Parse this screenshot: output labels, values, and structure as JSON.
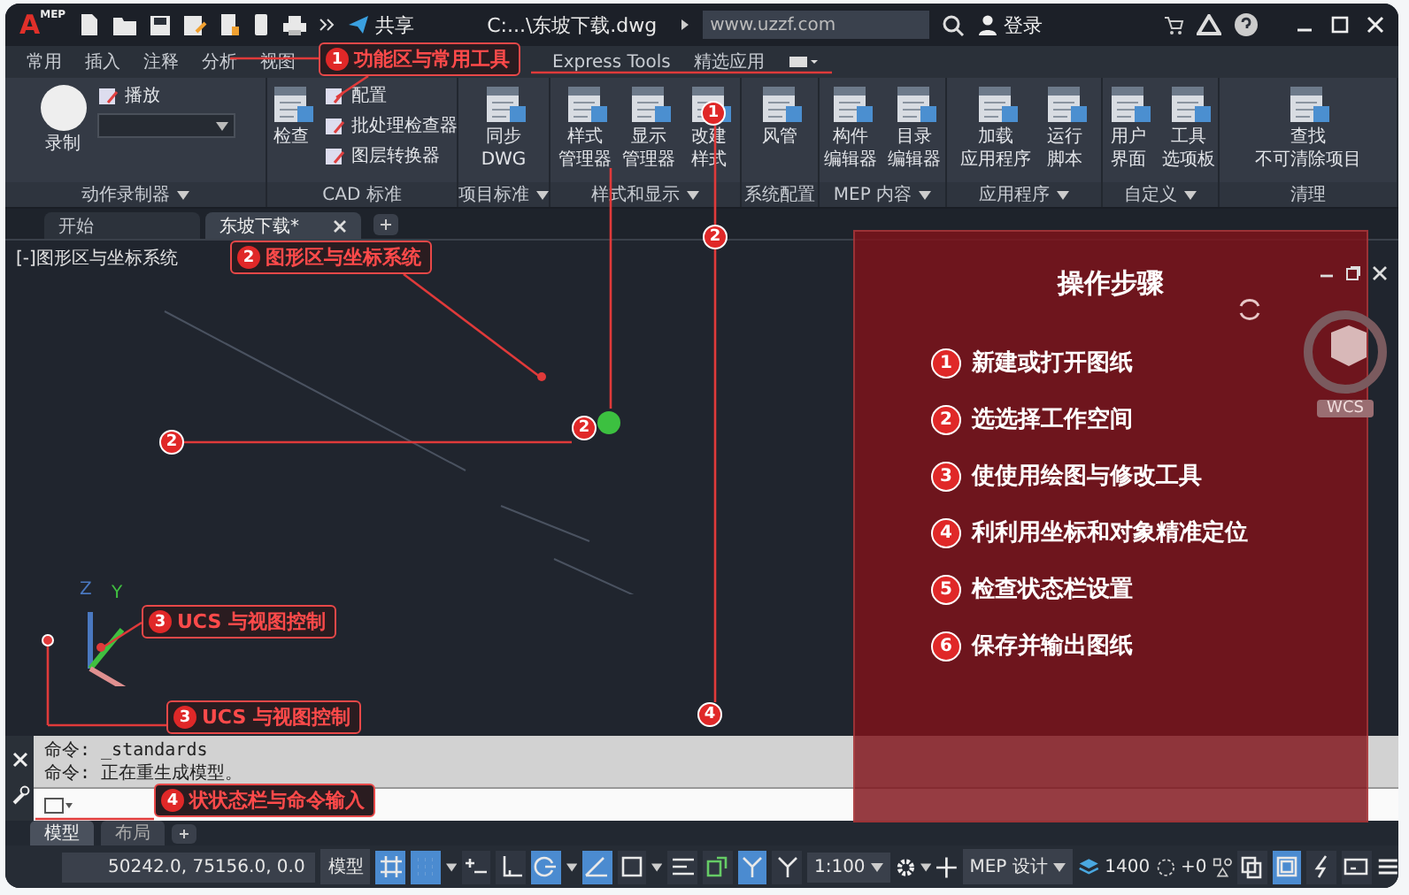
{
  "title_bar": {
    "logo": "A",
    "logo_badge": "MEP",
    "share": "共享",
    "file_title": "C:...\\东坡下载.dwg",
    "search": {
      "value": "www.uzzf.com"
    },
    "login": "登录"
  },
  "ribbon_tabs": [
    "常用",
    "插入",
    "注释",
    "分析",
    "视图",
    "Express Tools",
    "精选应用"
  ],
  "ribbon_panels": [
    {
      "title": "动作录制器",
      "has_menu": true,
      "tools": [
        {
          "kind": "record",
          "lines": [
            "录制"
          ]
        },
        {
          "kind": "small",
          "lines": [
            "播放"
          ]
        },
        {
          "kind": "combo"
        }
      ]
    },
    {
      "title": "CAD 标准",
      "has_menu": false,
      "tools": [
        {
          "kind": "large",
          "lines": [
            "检查"
          ]
        },
        {
          "kind": "small",
          "lines": [
            "配置"
          ]
        },
        {
          "kind": "small",
          "lines": [
            "批处理检查器"
          ]
        },
        {
          "kind": "small",
          "lines": [
            "图层转换器"
          ]
        }
      ]
    },
    {
      "title": "项目标准",
      "has_menu": true,
      "tools": [
        {
          "kind": "large",
          "lines": [
            "同步",
            "DWG"
          ]
        }
      ]
    },
    {
      "title": "样式和显示",
      "has_menu": true,
      "tools": [
        {
          "kind": "large",
          "lines": [
            "样式",
            "管理器"
          ]
        },
        {
          "kind": "large",
          "lines": [
            "显示",
            "管理器"
          ]
        },
        {
          "kind": "large",
          "lines": [
            "改建",
            "样式"
          ]
        }
      ]
    },
    {
      "title": "系统配置",
      "has_menu": false,
      "tools": [
        {
          "kind": "large",
          "lines": [
            "风管"
          ]
        }
      ]
    },
    {
      "title": "MEP 内容",
      "has_menu": true,
      "tools": [
        {
          "kind": "large",
          "lines": [
            "构件",
            "编辑器"
          ]
        },
        {
          "kind": "large",
          "lines": [
            "目录",
            "编辑器"
          ]
        }
      ]
    },
    {
      "title": "应用程序",
      "has_menu": true,
      "tools": [
        {
          "kind": "large",
          "lines": [
            "加载",
            "应用程序"
          ]
        },
        {
          "kind": "large",
          "lines": [
            "运行",
            "脚本"
          ]
        }
      ]
    },
    {
      "title": "自定义",
      "has_menu": true,
      "tools": [
        {
          "kind": "large",
          "lines": [
            "用户",
            "界面"
          ]
        },
        {
          "kind": "large",
          "lines": [
            "工具",
            "选项板"
          ]
        }
      ]
    },
    {
      "title": "清理",
      "has_menu": false,
      "tools": [
        {
          "kind": "large",
          "lines": [
            "查找",
            "不可清除项目"
          ]
        }
      ]
    }
  ],
  "doc_tabs": [
    {
      "label": "开始",
      "selected": false
    },
    {
      "label": "东坡下载*",
      "selected": true
    }
  ],
  "viewport": {
    "label": "[-]图形区与坐标系统",
    "ucs_z": "Z",
    "ucs_y": "Y",
    "viewcube_label": "WCS"
  },
  "command": {
    "history": [
      "命令: _standards",
      "命令: 正在重生成模型。"
    ]
  },
  "layout_tabs": [
    {
      "label": "模型",
      "selected": true
    },
    {
      "label": "布局",
      "selected": false
    }
  ],
  "status_bar": {
    "coordinates": "50242.0, 75156.0, 0.0",
    "space": "模型",
    "toggles": [
      {
        "on": true
      },
      {
        "on": true
      },
      {
        "on": false
      },
      {
        "on": false
      },
      {
        "on": true
      },
      {
        "on": true
      },
      {
        "on": false
      },
      {
        "on": false
      },
      {
        "on": false
      },
      {
        "on": true
      },
      {
        "on": false
      }
    ],
    "scale": "1:100",
    "workspace": "MEP 设计",
    "layer_count": "1400",
    "offset": "+0",
    "right_toggles": [
      {
        "on": false
      },
      {
        "on": true
      },
      {
        "on": false
      },
      {
        "on": false
      }
    ]
  },
  "steps_panel": {
    "title": "操作步骤",
    "steps": [
      {
        "number": "1",
        "text": "新建或打开图纸"
      },
      {
        "number": "2",
        "text": "选选择工作空间"
      },
      {
        "number": "3",
        "text": "使使用绘图与修改工具"
      },
      {
        "number": "4",
        "text": "利利用坐标和对象精准定位"
      },
      {
        "number": "5",
        "text": "检查状态栏设置"
      },
      {
        "number": "6",
        "text": "保存并输出图纸"
      }
    ]
  },
  "annotations": {
    "callouts": [
      {
        "number": "1",
        "text": "功能区与常用工具"
      },
      {
        "number": "2",
        "text": "图形区与坐标系统"
      },
      {
        "number": "3",
        "text": "UCS 与视图控制"
      },
      {
        "number": "3",
        "text": "UCS 与视图控制"
      },
      {
        "number": "4",
        "text": "状状态栏与命令输入"
      }
    ],
    "markers": [
      "1",
      "2",
      "2",
      "2",
      "4"
    ]
  }
}
